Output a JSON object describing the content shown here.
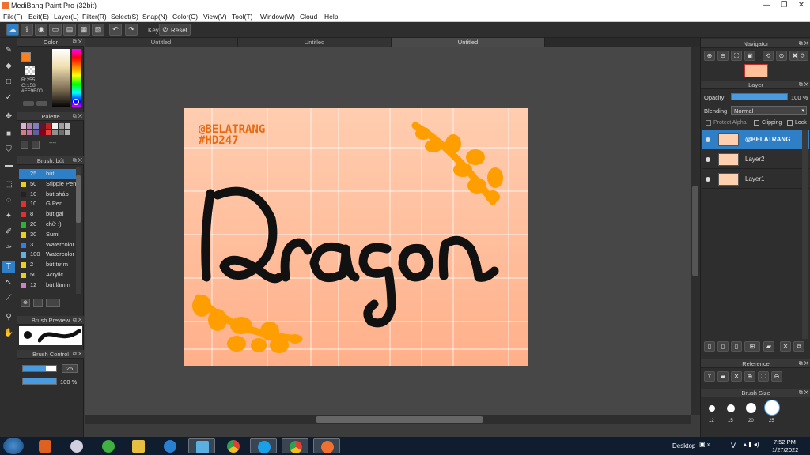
{
  "window": {
    "title": "MediBang Paint Pro (32bit)",
    "min": "—",
    "max": "❐",
    "close": "✕"
  },
  "menu": [
    "File(F)",
    "Edit(E)",
    "Layer(L)",
    "Filter(R)",
    "Select(S)",
    "Snap(N)",
    "Color(C)",
    "View(V)",
    "Tool(T)",
    "Window(W)",
    "Cloud",
    "Help"
  ],
  "toolbar": {
    "key_label": "Key",
    "reset_label": "Reset"
  },
  "tabs": [
    "Untitled",
    "Untitled",
    "Untitled"
  ],
  "color_panel": {
    "title": "Color",
    "r": "R:255",
    "g": "G:158",
    "hex": "#FF9E00",
    "primary": "#FF7F1A"
  },
  "palette_panel": {
    "title": "Palette",
    "colors": [
      "#e0b0d0",
      "#b080b0",
      "#8080c0",
      "#5a1a2a",
      "#c02020",
      "#f0f0f0",
      "#a0a0a0",
      "#c0c0c0",
      "#d08080",
      "#c070a0",
      "#6060a0",
      "#8a0010",
      "#e04040",
      "#909090",
      "#707070",
      "#b0b0b0"
    ],
    "dash": "----"
  },
  "brush_panel": {
    "title": "Brush: bút",
    "items": [
      {
        "size": "25",
        "name": "bút",
        "color": "#2f7fc7"
      },
      {
        "size": "50",
        "name": "Stipple Pen",
        "color": "#e8d020"
      },
      {
        "size": "10",
        "name": "bút sháp",
        "color": "#222222"
      },
      {
        "size": "10",
        "name": "G Pen",
        "color": "#e03030"
      },
      {
        "size": "8",
        "name": "bút gai",
        "color": "#e03030"
      },
      {
        "size": "20",
        "name": "chữ :)",
        "color": "#30b030"
      },
      {
        "size": "30",
        "name": "Sumi",
        "color": "#e8d020"
      },
      {
        "size": "3",
        "name": "Watercolor",
        "color": "#3080e0"
      },
      {
        "size": "100",
        "name": "Watercolor",
        "color": "#60b0e0"
      },
      {
        "size": "2",
        "name": "bút tự m",
        "color": "#e8d020"
      },
      {
        "size": "50",
        "name": "Acrylic",
        "color": "#e8d020"
      },
      {
        "size": "12",
        "name": "bút lâm n",
        "color": "#d080c0"
      }
    ]
  },
  "brush_preview": {
    "title": "Brush Preview"
  },
  "brush_control": {
    "title": "Brush Control",
    "size": "25",
    "opacity": "100 %",
    "size_fraction": 0.7,
    "opacity_fraction": 1.0
  },
  "navigator": {
    "title": "Navigator"
  },
  "layer_panel": {
    "title": "Layer",
    "opacity_label": "Opacity",
    "opacity_value": "100 %",
    "opacity_fraction": 1.0,
    "blending_label": "Blending",
    "blending_value": "Normal",
    "protect_alpha": "Protect Alpha",
    "clipping": "Clipping",
    "lock": "Lock",
    "layers": [
      {
        "name": "@BELATRANG",
        "selected": true
      },
      {
        "name": "Layer2",
        "selected": false
      },
      {
        "name": "Layer1",
        "selected": false
      }
    ]
  },
  "reference": {
    "title": "Reference"
  },
  "brush_size": {
    "title": "Brush Size",
    "sizes": [
      "12",
      "15",
      "20",
      "25"
    ]
  },
  "artwork": {
    "handle": "@BELATRANG",
    "tag": "#HD247",
    "word": "Dragon",
    "bg_top": "#FFCDB0",
    "bg_bottom": "#FFB08A",
    "accent": "#FF9E00",
    "text_accent": "#E86A10"
  },
  "taskbar": {
    "desktop": "Desktop",
    "time": "7:52 PM",
    "date": "1/27/2022",
    "lang": "V"
  }
}
